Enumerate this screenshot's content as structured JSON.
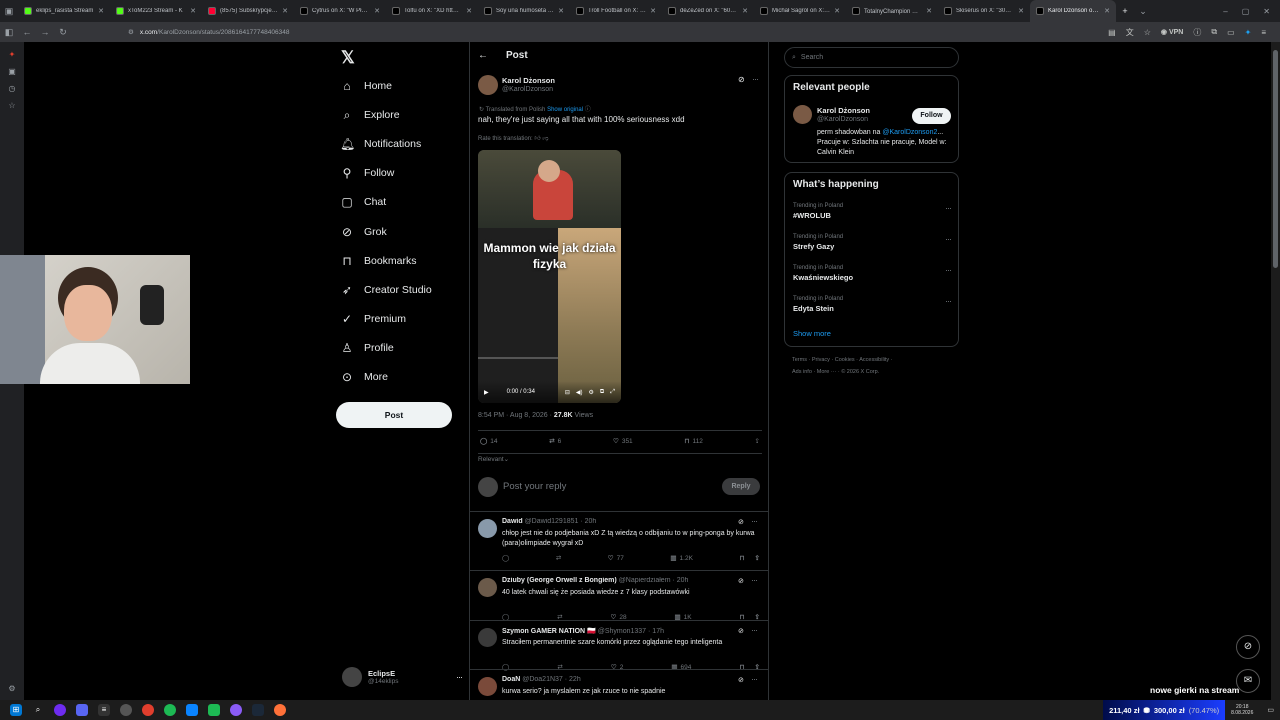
{
  "browser": {
    "tabs": [
      {
        "title": "eklips_rasista Stream",
        "color": "#53fc18"
      },
      {
        "title": "xToM223 Stream - K",
        "color": "#53fc18"
      },
      {
        "title": "(8575) Subskrypcje - You",
        "color": "#ff0033"
      },
      {
        "title": "Cytrus on X: \"W Płocku z",
        "color": "#000000"
      },
      {
        "title": "Tolfu on X: \"XD https://t",
        "color": "#000000"
      },
      {
        "title": "Soy una humoseta on X",
        "color": "#000000"
      },
      {
        "title": "Troll Football on X: \"New",
        "color": "#000000"
      },
      {
        "title": "deZeZed on X: \"60-latek",
        "color": "#000000"
      },
      {
        "title": "Michał Sagrol on X: \"XD",
        "color": "#000000"
      },
      {
        "title": "TotalnyChampion 😎🏁",
        "color": "#000000"
      },
      {
        "title": "Skiserus on X: \"300 mo",
        "color": "#000000"
      },
      {
        "title": "Karol Dżonson on X",
        "color": "#000000",
        "active": true
      }
    ],
    "new_tab": "+",
    "url_domain": "x.com",
    "url_path": "/KarolDzonson/status/2086164177748406348",
    "vpn": "VPN"
  },
  "sidebar": {
    "items": [
      {
        "label": "Home",
        "icon": "home-icon"
      },
      {
        "label": "Explore",
        "icon": "search-icon"
      },
      {
        "label": "Notifications",
        "icon": "bell-icon"
      },
      {
        "label": "Follow",
        "icon": "follow-icon"
      },
      {
        "label": "Chat",
        "icon": "chat-icon"
      },
      {
        "label": "Grok",
        "icon": "grok-icon"
      },
      {
        "label": "Bookmarks",
        "icon": "bookmark-icon"
      },
      {
        "label": "Creator Studio",
        "icon": "rocket-icon"
      },
      {
        "label": "Premium",
        "icon": "premium-icon"
      },
      {
        "label": "Profile",
        "icon": "person-icon"
      },
      {
        "label": "More",
        "icon": "more-icon"
      }
    ],
    "post_button": "Post",
    "account": {
      "name": "EclipsE",
      "handle": "@14eklips"
    }
  },
  "main": {
    "header": "Post",
    "tweet": {
      "author": "Karol Dżonson",
      "handle": "@KarolDzonson",
      "translated_from": "Translated from Polish",
      "show_original": "Show original",
      "text": "nah, they're just saying all that with 100% seriousness xdd",
      "rate_translation": "Rate this translation:",
      "video_caption": "Mammon wie jak działa fizyka",
      "video_time": "0:00 / 0:34",
      "timestamp": "8:54 PM · Aug 8, 2026 · ",
      "views": "27.8K",
      "views_label": "Views",
      "stats": {
        "replies": "14",
        "reposts": "6",
        "likes": "351",
        "bookmarks": "112"
      }
    },
    "sort": "Relevant",
    "reply_placeholder": "Post your reply",
    "reply_button": "Reply",
    "replies": [
      {
        "name": "Dawid",
        "handle": "@Dawid1291851",
        "time": "· 20h",
        "text": "chłop jest nie do podjebania xD Z tą wiedzą o odbijaniu to w ping-ponga by kurwa (para)olimpiade wygrał xD",
        "likes": "77",
        "views": "1.2K"
      },
      {
        "name": "Dziuby (George Orwell z Bongiem)",
        "handle": "@Napierdziałem",
        "time": "· 20h",
        "text": "40 latek chwali się że posiada wiedze z 7 klasy podstawówki",
        "likes": "28",
        "views": "1K"
      },
      {
        "name": "Szymon GAMER NATION 🇵🇱",
        "handle": "@Shymon1337",
        "time": "· 17h",
        "text": "Straciłem permanentnie szare komórki przez oglądanie tego inteligenta",
        "likes": "2",
        "views": "694"
      },
      {
        "name": "DoaN",
        "handle": "@Doa21N37",
        "time": "· 22h",
        "text": "kurwa serio? ja myslalem ze jak rzuce to nie spadnie",
        "likes": "",
        "views": ""
      }
    ]
  },
  "right": {
    "search_placeholder": "Search",
    "relevant_title": "Relevant people",
    "person": {
      "name": "Karol Dżonson",
      "handle": "@KarolDzonson",
      "follow": "Follow",
      "bio_prefix": "perm shadowban na ",
      "bio_link": "@KarolDzonson2",
      "bio_rest": "... Pracuje w: Szlachta nie pracuje, Model w: Calvin Klein"
    },
    "happening_title": "What’s happening",
    "trends": [
      {
        "category": "Trending in Poland",
        "title": "#WROLUB"
      },
      {
        "category": "Trending in Poland",
        "title": "Strefy Gazy"
      },
      {
        "category": "Trending in Poland",
        "title": "Kwaśniewskiego"
      },
      {
        "category": "Trending in Poland",
        "title": "Edyta Stein"
      }
    ],
    "show_more": "Show more",
    "footer1": "Terms  ·  Privacy  ·  Cookies  ·  Accessibility  ·",
    "footer2": "Ads info  ·  More ···  ·  © 2026 X Corp."
  },
  "overlay": {
    "stream_text": "nowe gierki na stream"
  },
  "taskbar": {
    "money": "211,40 zł",
    "money2": "300,00 zł",
    "money3": "(70.47%)",
    "clock": "20:18",
    "date": "8.08.2026"
  }
}
